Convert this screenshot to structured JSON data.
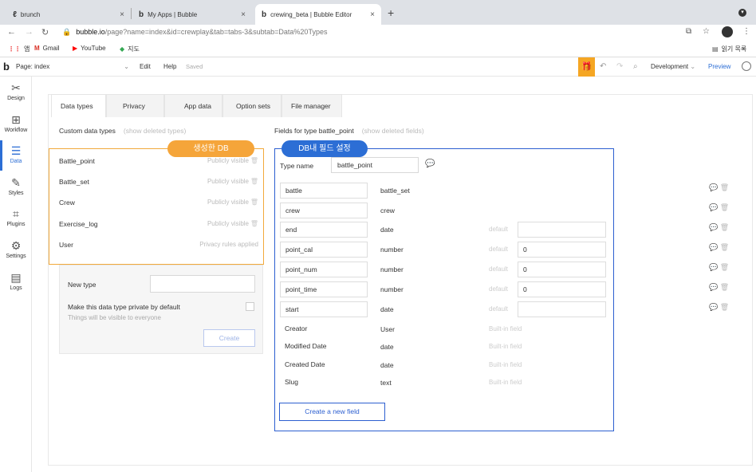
{
  "browser": {
    "tabs": [
      {
        "icon": "ℓ",
        "label": "brunch",
        "close": "×"
      },
      {
        "icon": "b",
        "label": "My Apps | Bubble",
        "close": "×"
      },
      {
        "icon": "b",
        "label": "crewing_beta | Bubble Editor",
        "close": "×"
      }
    ],
    "new_tab": "+",
    "url_domain": "bubble.io",
    "url_path": "/page?name=index&id=crewplay&tab=tabs-3&subtab=Data%20Types",
    "bookmarks": [
      {
        "icon": "apps-grid-icon",
        "label": "앱"
      },
      {
        "icon": "gmail-icon",
        "label": "Gmail"
      },
      {
        "icon": "youtube-icon",
        "label": "YouTube"
      },
      {
        "icon": "maps-icon",
        "label": "지도"
      }
    ],
    "reading_list": "읽기 목록"
  },
  "editor": {
    "logo": "b",
    "page_selector": "Page: index",
    "menu": [
      "Edit",
      "Help"
    ],
    "saved_status": "Saved",
    "environment": "Development",
    "preview": "Preview",
    "accent": "#2c6ed5",
    "gift_color": "#f5a623"
  },
  "sidebar": {
    "items": [
      {
        "label": "Design",
        "icon": "design-icon"
      },
      {
        "label": "Workflow",
        "icon": "workflow-icon"
      },
      {
        "label": "Data",
        "icon": "database-icon",
        "active": true
      },
      {
        "label": "Styles",
        "icon": "brush-icon"
      },
      {
        "label": "Plugins",
        "icon": "plugin-icon"
      },
      {
        "label": "Settings",
        "icon": "gear-icon"
      },
      {
        "label": "Logs",
        "icon": "logs-icon"
      }
    ]
  },
  "data_tabs": [
    "Data types",
    "Privacy",
    "App data",
    "Option sets",
    "File manager"
  ],
  "custom_types": {
    "heading": "Custom data types",
    "hint": "(show deleted types)",
    "callout": "생성한 DB",
    "rows": [
      {
        "name": "Battle_point",
        "visibility": "Publicly visible"
      },
      {
        "name": "Battle_set",
        "visibility": "Publicly visible"
      },
      {
        "name": "Crew",
        "visibility": "Publicly visible"
      },
      {
        "name": "Exercise_log",
        "visibility": "Publicly visible"
      },
      {
        "name": "User",
        "visibility": "Privacy rules applied"
      }
    ]
  },
  "new_type": {
    "label": "New type",
    "value": "",
    "private_label": "Make this data type private by default",
    "private_sub": "Things will be visible to everyone",
    "create_button": "Create"
  },
  "fields": {
    "heading": "Fields for type battle_point",
    "hint": "(show deleted fields)",
    "callout": "DB내 필드 설정",
    "type_name_label": "Type name",
    "type_name_value": "battle_point",
    "default_label": "default",
    "builtin_label": "Built-in field",
    "custom_rows": [
      {
        "name": "battle",
        "type": "battle_set",
        "has_default": false,
        "default": ""
      },
      {
        "name": "crew",
        "type": "crew",
        "has_default": false,
        "default": ""
      },
      {
        "name": "end",
        "type": "date",
        "has_default": true,
        "default": ""
      },
      {
        "name": "point_cal",
        "type": "number",
        "has_default": true,
        "default": "0"
      },
      {
        "name": "point_num",
        "type": "number",
        "has_default": true,
        "default": "0"
      },
      {
        "name": "point_time",
        "type": "number",
        "has_default": true,
        "default": "0"
      },
      {
        "name": "start",
        "type": "date",
        "has_default": true,
        "default": ""
      }
    ],
    "builtin_rows": [
      {
        "name": "Creator",
        "type": "User"
      },
      {
        "name": "Modified Date",
        "type": "date"
      },
      {
        "name": "Created Date",
        "type": "date"
      },
      {
        "name": "Slug",
        "type": "text"
      }
    ],
    "create_button": "Create a new field"
  }
}
